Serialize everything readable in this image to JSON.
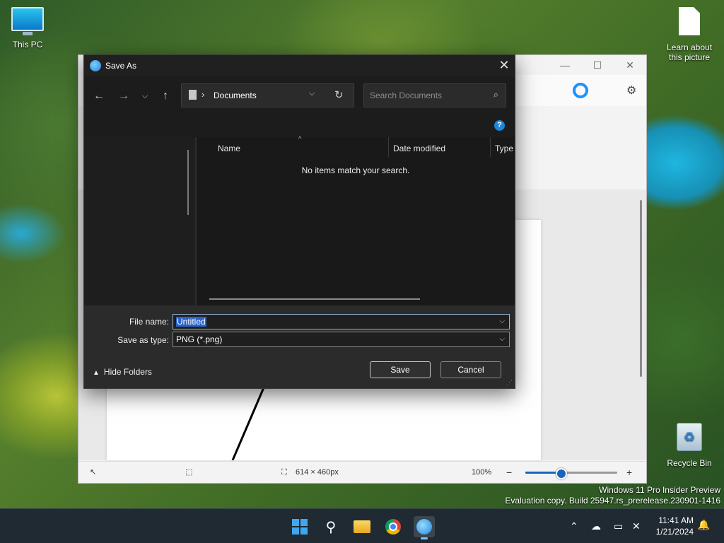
{
  "desktop": {
    "this_pc_label": "This PC",
    "learn_label_1": "Learn about",
    "learn_label_2": "this picture",
    "recycle_bin_label": "Recycle Bin",
    "watermark_line1": "Windows 11 Pro Insider Preview",
    "watermark_line2": "Evaluation copy. Build 25947.rs_prerelease.230901-1416"
  },
  "paint": {
    "status": {
      "canvas_size": "614 × 460px",
      "zoom_level": "100%",
      "zoom_fraction": 0.39
    }
  },
  "dialog": {
    "title": "Save As",
    "address": {
      "separator": "›",
      "path": "Documents"
    },
    "search": {
      "placeholder": "Search Documents"
    },
    "columns": [
      "Name",
      "Date modified",
      "Type"
    ],
    "empty_message": "No items match your search.",
    "file_name_label": "File name:",
    "file_name_value": "Untitled",
    "save_type_label": "Save as type:",
    "save_type_value": "PNG (*.png)",
    "hide_folders_label": "Hide Folders",
    "save_label": "Save",
    "cancel_label": "Cancel"
  },
  "taskbar": {
    "time": "11:41 AM",
    "date": "1/21/2024"
  },
  "icons": {
    "back": "arrow-left-icon",
    "forward": "arrow-right-icon",
    "recent": "chevron-down-icon",
    "up": "arrow-up-icon",
    "refresh": "refresh-icon",
    "search": "search-icon",
    "help": "help-icon"
  },
  "colors": {
    "dialog_bg": "#202020",
    "accent": "#1466c4",
    "selection": "#2b63c8",
    "taskbar": "#1f2a33"
  }
}
